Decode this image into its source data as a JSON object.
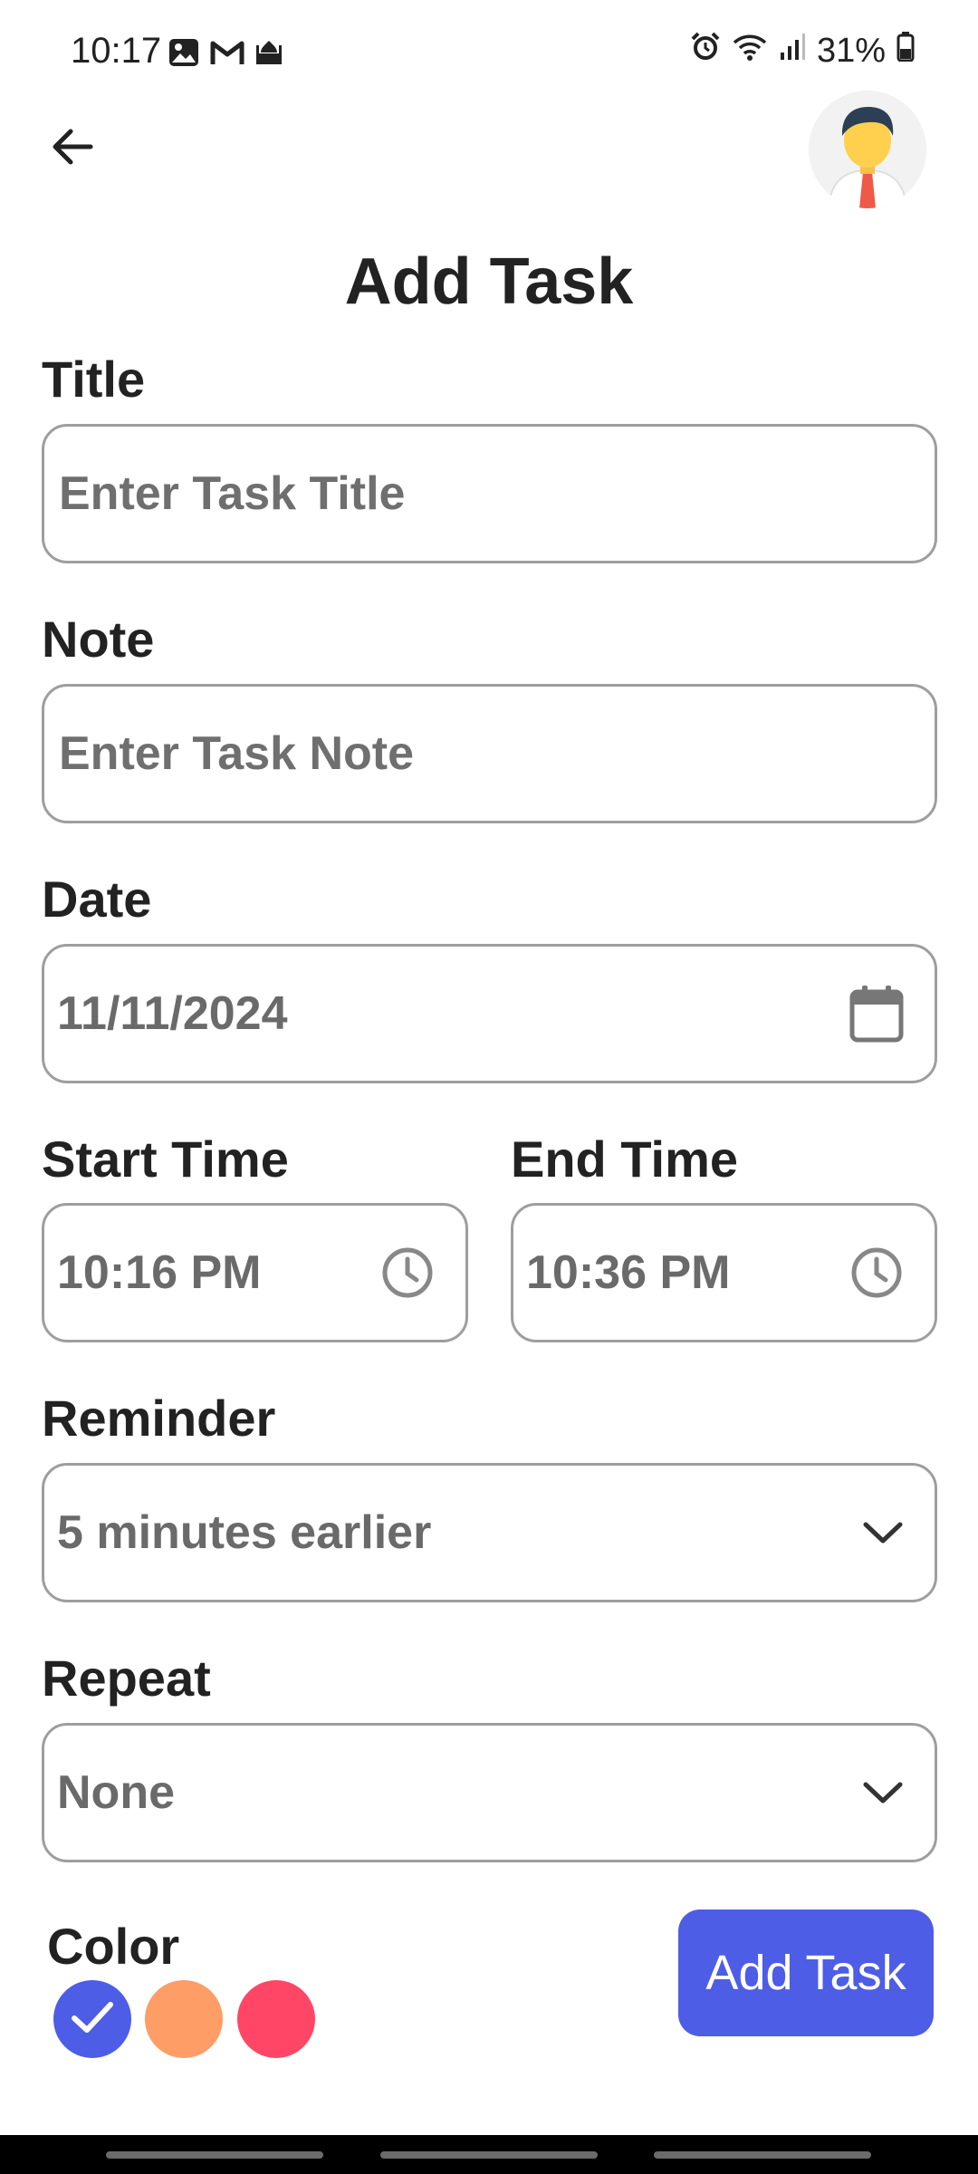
{
  "status_bar": {
    "time": "10:17",
    "battery_percent": "31%",
    "left_icons": [
      "gallery-icon",
      "gmail-icon",
      "mosque-icon"
    ],
    "right_icons": [
      "alarm-icon",
      "wifi-icon",
      "signal-icon",
      "battery-icon"
    ]
  },
  "header": {
    "title": "Add Task",
    "back_icon": "arrow-left-icon",
    "avatar_icon": "user-avatar"
  },
  "form": {
    "title": {
      "label": "Title",
      "placeholder": "Enter Task Title"
    },
    "note": {
      "label": "Note",
      "placeholder": "Enter Task Note"
    },
    "date": {
      "label": "Date",
      "value": "11/11/2024",
      "icon": "calendar-icon"
    },
    "start_time": {
      "label": "Start Time",
      "value": "10:16 PM",
      "icon": "clock-icon"
    },
    "end_time": {
      "label": "End Time",
      "value": "10:36 PM",
      "icon": "clock-icon"
    },
    "reminder": {
      "label": "Reminder",
      "value": "5 minutes earlier",
      "icon": "chevron-down-icon"
    },
    "repeat": {
      "label": "Repeat",
      "value": "None",
      "icon": "chevron-down-icon"
    }
  },
  "color_picker": {
    "label": "Color",
    "options": [
      {
        "color": "#4e5de6",
        "selected": true
      },
      {
        "color": "#ff9d66",
        "selected": false
      },
      {
        "color": "#ff4667",
        "selected": false
      }
    ]
  },
  "submit": {
    "label": "Add Task",
    "color": "#4e5de6"
  }
}
